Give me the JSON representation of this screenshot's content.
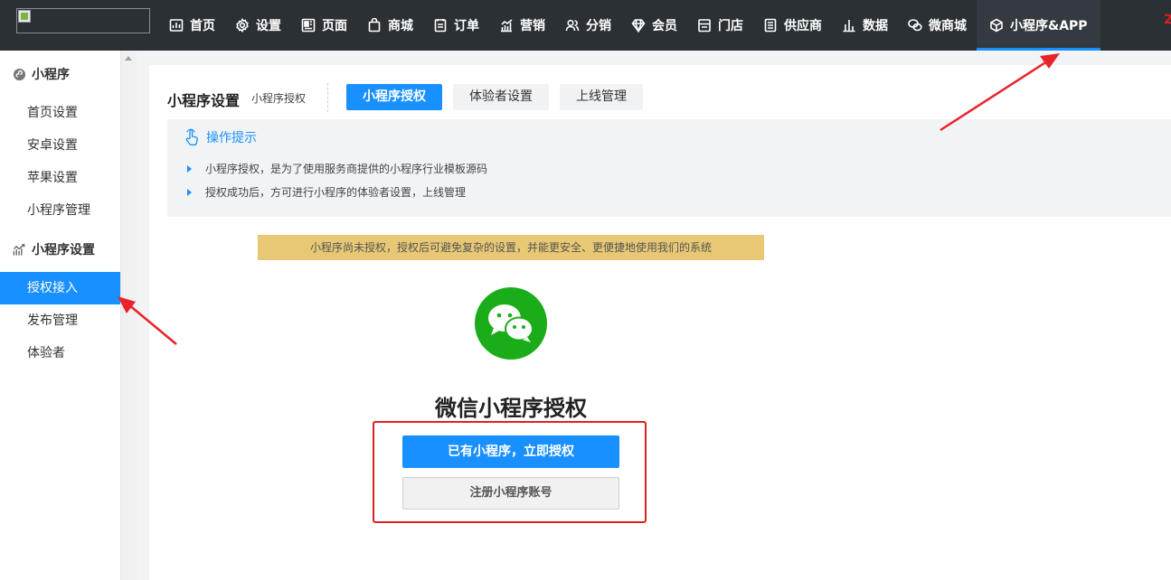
{
  "topnav": {
    "items": [
      {
        "label": "首页",
        "icon": "dashboard-icon"
      },
      {
        "label": "设置",
        "icon": "gear-icon"
      },
      {
        "label": "页面",
        "icon": "page-icon"
      },
      {
        "label": "商城",
        "icon": "bag-icon"
      },
      {
        "label": "订单",
        "icon": "order-icon"
      },
      {
        "label": "营销",
        "icon": "marketing-icon"
      },
      {
        "label": "分销",
        "icon": "users-icon"
      },
      {
        "label": "会员",
        "icon": "diamond-icon"
      },
      {
        "label": "门店",
        "icon": "store-icon"
      },
      {
        "label": "供应商",
        "icon": "supplier-icon"
      },
      {
        "label": "数据",
        "icon": "bar-chart-icon"
      },
      {
        "label": "微商城",
        "icon": "wechat-icon"
      },
      {
        "label": "小程序&APP",
        "icon": "cube-icon"
      }
    ],
    "active_index": 12,
    "extra": "2"
  },
  "sidebar": {
    "groups": [
      {
        "label": "小程序",
        "icon": "mini-program-icon"
      },
      {
        "label": "小程序设置",
        "icon": "trend-chart-icon"
      }
    ],
    "items": [
      {
        "label": "首页设置"
      },
      {
        "label": "安卓设置"
      },
      {
        "label": "苹果设置"
      },
      {
        "label": "小程序管理"
      },
      {
        "label": "授权接入"
      },
      {
        "label": "发布管理"
      },
      {
        "label": "体验者"
      }
    ],
    "active_index": 4
  },
  "header": {
    "title": "小程序设置",
    "subtitle": "小程序授权",
    "tabs": [
      {
        "label": "小程序授权"
      },
      {
        "label": "体验者设置"
      },
      {
        "label": "上线管理"
      }
    ],
    "active_tab": 0
  },
  "tips": {
    "title": "操作提示",
    "lines": [
      "小程序授权，是为了使用服务商提供的小程序行业模板源码",
      "授权成功后，方可进行小程序的体验者设置，上线管理"
    ]
  },
  "notice": "小程序尚未授权，授权后可避免复杂的设置，并能更安全、更便捷地使用我们的系统",
  "auth": {
    "title": "微信小程序授权",
    "primary_button": "已有小程序，立即授权",
    "secondary_button": "注册小程序账号"
  },
  "colors": {
    "topbar": "#2b3035",
    "accent": "#1890ff",
    "wechat_green": "#1aad19",
    "notice_bg": "#e8c874",
    "annotation_red": "#e02020"
  }
}
